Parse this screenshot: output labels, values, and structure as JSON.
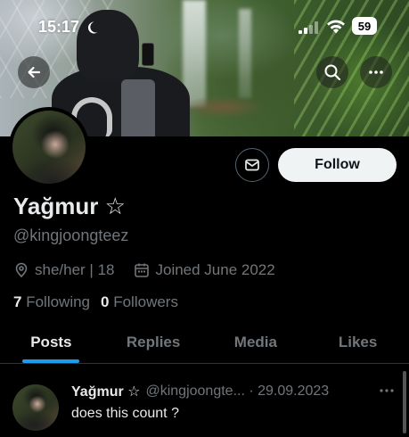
{
  "status_bar": {
    "time": "15:17",
    "moon_icon": "moon-icon",
    "signal_icon": "signal-icon",
    "wifi_icon": "wifi-icon",
    "battery_level": "59"
  },
  "header": {
    "back_icon": "arrow-left-icon",
    "search_icon": "search-icon",
    "more_icon": "more-horizontal-icon"
  },
  "profile": {
    "display_name": "Yağmur ☆",
    "handle": "@kingjoongteez",
    "pronouns": "she/her | 18",
    "joined": "Joined June 2022",
    "following_count": "7",
    "following_label": "Following",
    "followers_count": "0",
    "followers_label": "Followers"
  },
  "actions": {
    "message_icon": "envelope-icon",
    "follow_label": "Follow"
  },
  "tabs": [
    {
      "label": "Posts",
      "active": true
    },
    {
      "label": "Replies",
      "active": false
    },
    {
      "label": "Media",
      "active": false
    },
    {
      "label": "Likes",
      "active": false
    }
  ],
  "post": {
    "name": "Yağmur ☆",
    "handle_date": "@kingjoongte... · 29.09.2023",
    "text": "does this count ?"
  },
  "colors": {
    "accent": "#1d9bf0",
    "background": "#000000",
    "text_primary": "#e7e9ea",
    "text_secondary": "#71767b",
    "follow_button": "#eff3f4"
  }
}
